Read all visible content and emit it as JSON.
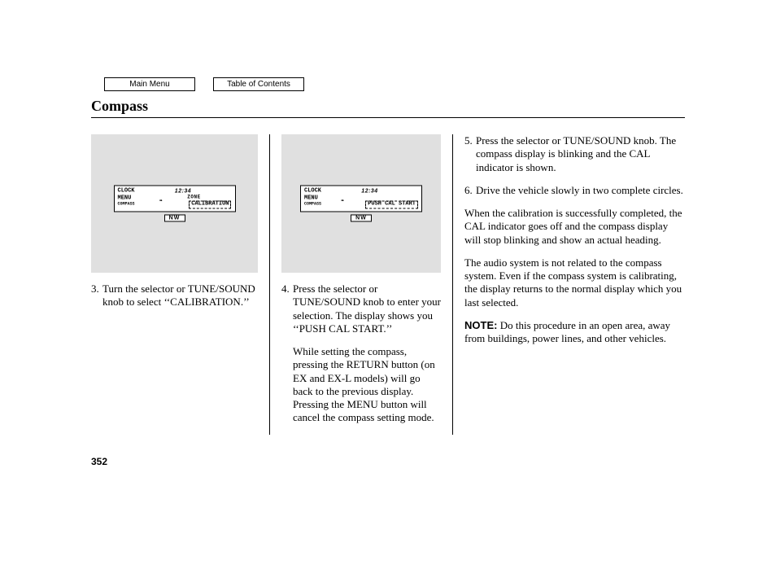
{
  "nav": {
    "main_menu": "Main Menu",
    "toc": "Table of Contents"
  },
  "title": "Compass",
  "page_number": "352",
  "illus1": {
    "clock_label": "CLOCK",
    "clock_time": "12:34",
    "menu_label": "MENU",
    "sub_label": "COMPASS",
    "zone_label": "ZONE",
    "highlight": "CALIBRATION",
    "direction": "NW"
  },
  "illus2": {
    "clock_label": "CLOCK",
    "clock_time": "12:34",
    "menu_label": "MENU",
    "sub_label": "COMPASS",
    "zone_label": "",
    "highlight": "PUSH CAL START",
    "direction": "NW"
  },
  "steps": {
    "s3_num": "3.",
    "s3_text": "Turn the selector or TUNE/SOUND knob to select ‘‘CALIBRATION.’’",
    "s4_num": "4.",
    "s4_text": "Press the selector or TUNE/SOUND knob to enter your selection. The display shows you ‘‘PUSH CAL START.’’",
    "s4b_text": "While setting the compass, pressing the RETURN button (on EX and EX-L models) will go back to the previous display. Pressing the MENU button will cancel the compass setting mode.",
    "s5_num": "5.",
    "s5_text": "Press the selector or TUNE/SOUND knob. The compass display is blinking and the CAL indicator is shown.",
    "s6_num": "6.",
    "s6_text": "Drive the vehicle slowly in two complete circles."
  },
  "paras": {
    "p1": "When the calibration is successfully completed, the CAL indicator goes off and the compass display will stop blinking and show an actual heading.",
    "p2": "The audio system is not related to the compass system. Even if the compass system is calibrating, the display returns to the normal display which you last selected.",
    "note_label": "NOTE:",
    "note_text": " Do this procedure in an open area, away from buildings, power lines, and other vehicles."
  }
}
